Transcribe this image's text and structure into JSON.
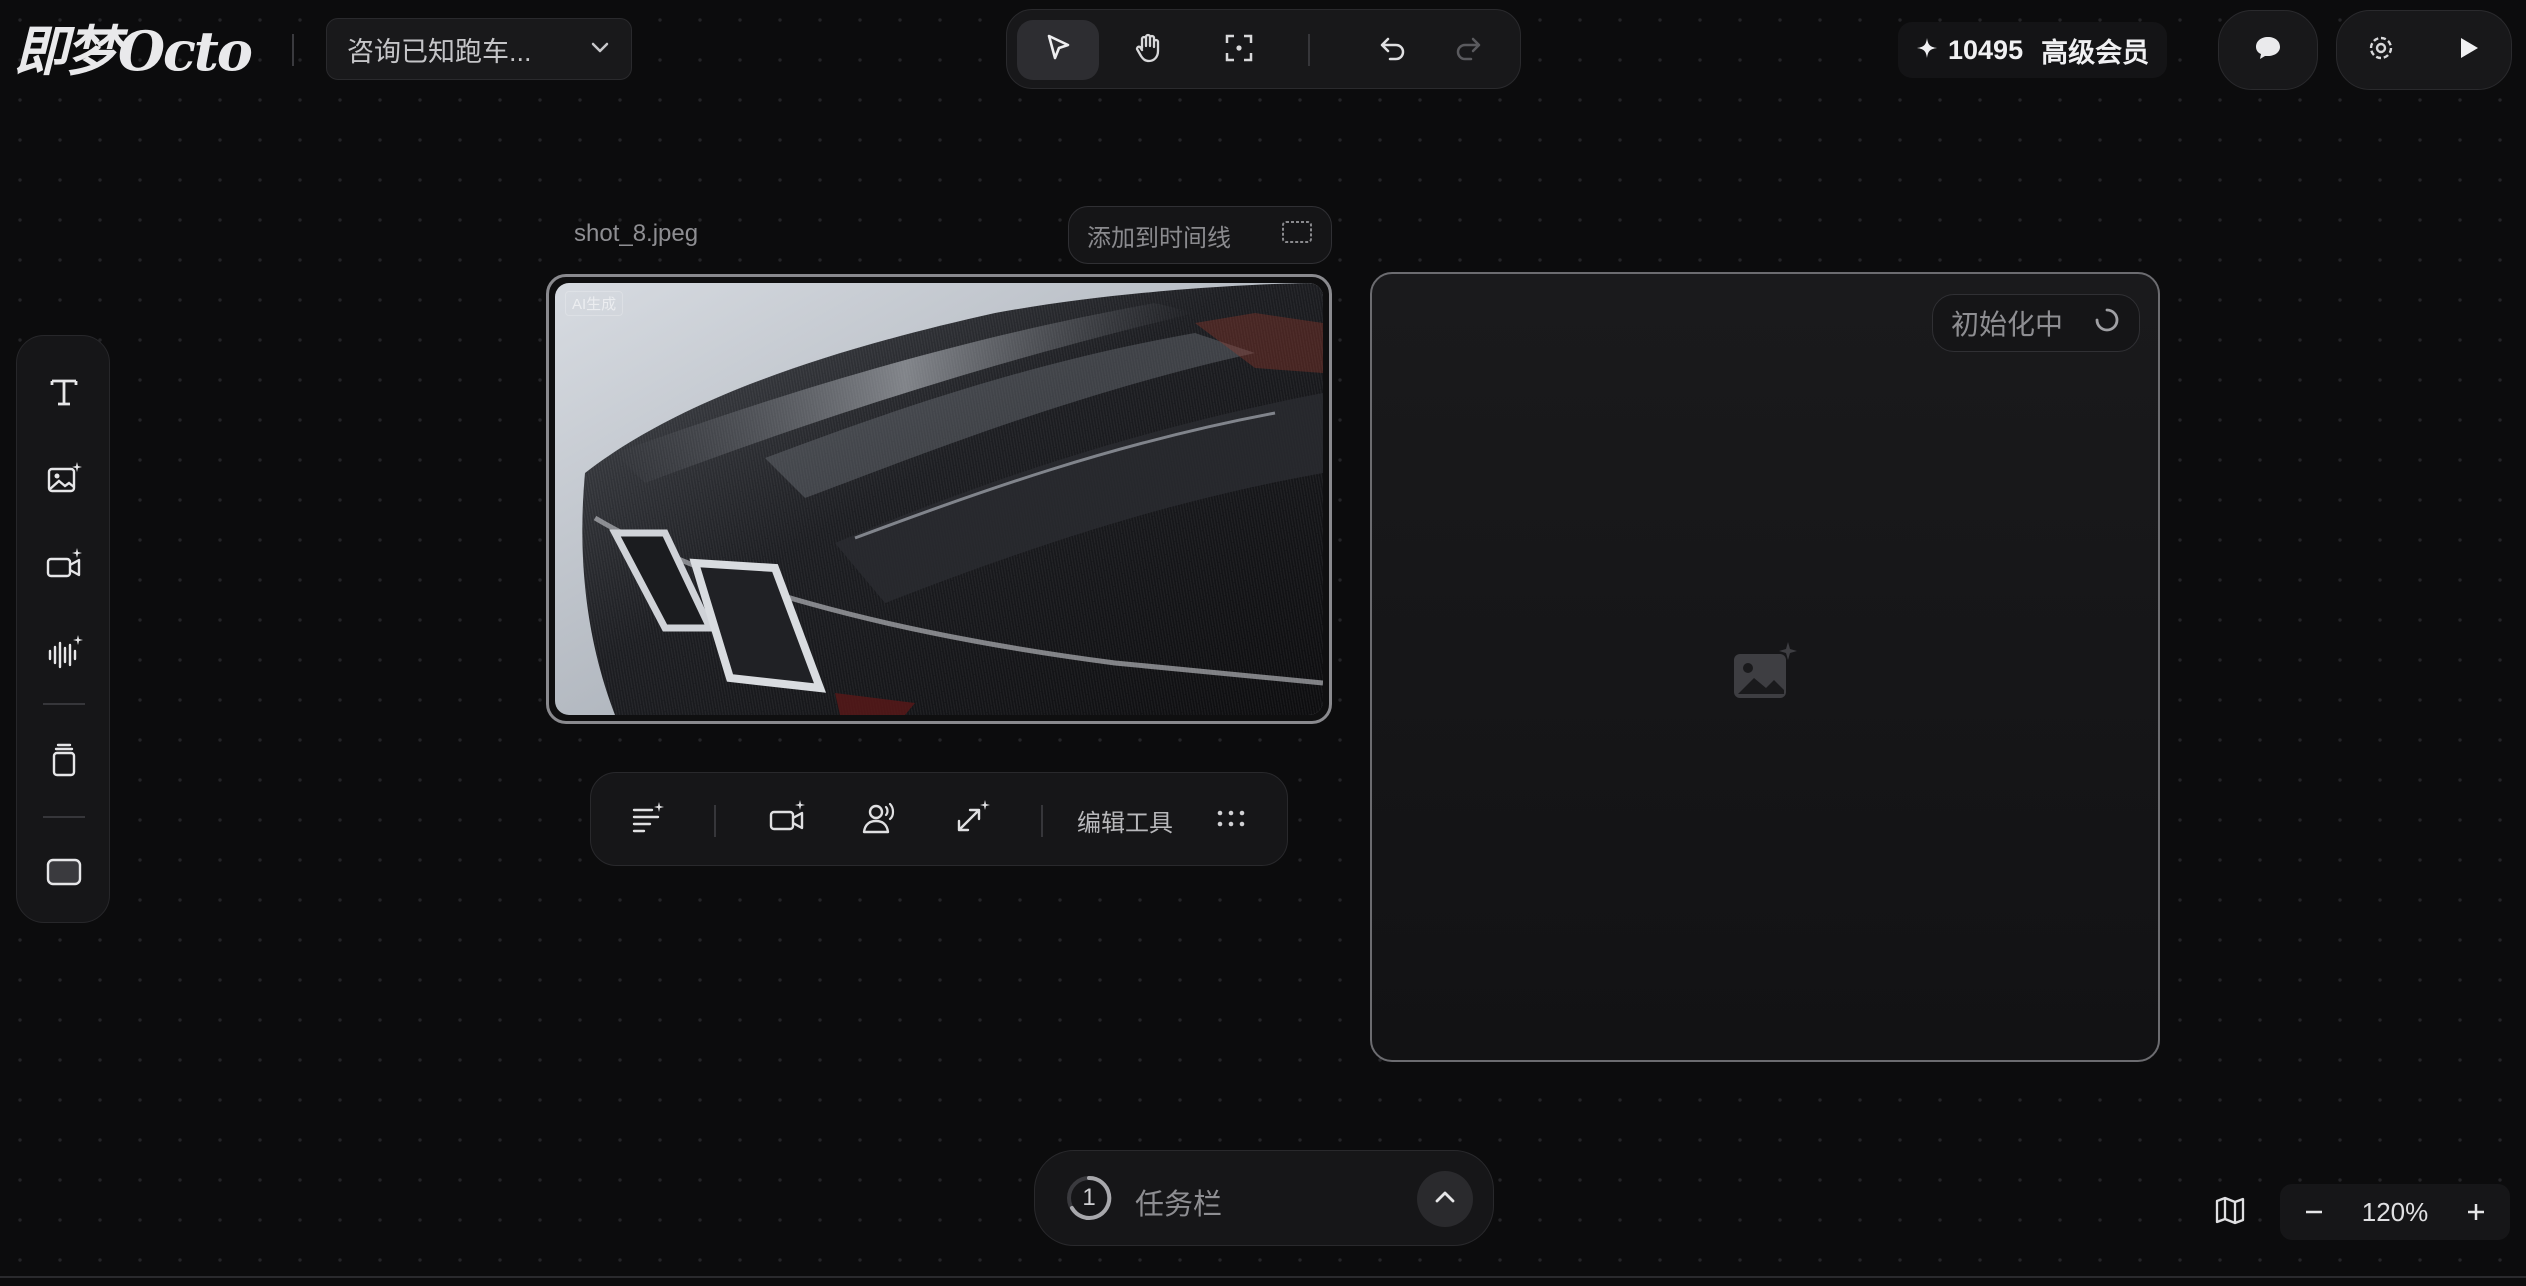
{
  "header": {
    "logo_text": "即梦Octo",
    "project_name": "咨询已知跑车...",
    "credits_value": "10495",
    "membership_label": "高级会员"
  },
  "toolbar": {
    "tools": [
      {
        "icon": "pointer-select-icon",
        "active": true
      },
      {
        "icon": "hand-pan-icon",
        "active": false
      },
      {
        "icon": "focus-frame-icon",
        "active": false
      },
      {
        "icon": "undo-icon",
        "active": false
      },
      {
        "icon": "redo-icon",
        "active": false
      }
    ]
  },
  "sidebar": {
    "tools": [
      "text-tool-icon",
      "image-generate-icon",
      "video-generate-icon",
      "audio-generate-icon",
      "layers-icon",
      "frame-icon"
    ]
  },
  "canvas": {
    "image_card": {
      "filename": "shot_8.jpeg",
      "add_timeline_label": "添加到时间线",
      "ai_badge": "AI生成"
    },
    "placeholder_card": {
      "status_label": "初始化中"
    }
  },
  "image_tools": {
    "icons": [
      "adjust-settings-icon",
      "image-to-video-icon",
      "voice-avatar-icon",
      "upscale-expand-icon",
      "more-dots-icon"
    ],
    "edit_tools_label": "编辑工具"
  },
  "taskbar": {
    "count": "1",
    "label": "任务栏"
  },
  "zoom": {
    "level": "120%"
  },
  "colors": {
    "background": "#0c0c0d",
    "panel": "#161618",
    "text": "#d6d6d8"
  }
}
